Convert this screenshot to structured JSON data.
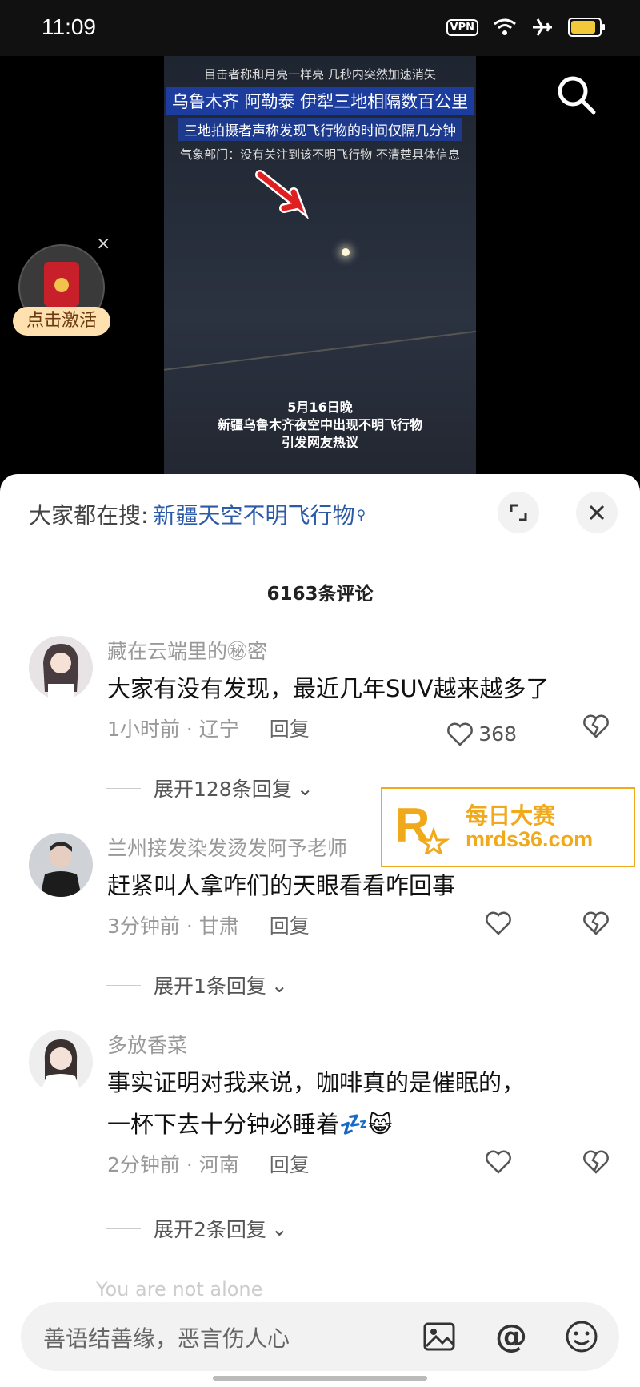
{
  "status_bar": {
    "time": "11:09",
    "vpn": "VPN",
    "battery_color": "#f0c83a",
    "battery_level": 0.9
  },
  "video": {
    "captions_top": [
      "目击者称和月亮一样亮 几秒内突然加速消失",
      "乌鲁木齐 阿勒泰 伊犁三地相隔数百公里",
      "三地拍摄者声称发现飞行物的时间仅隔几分钟",
      "气象部门：没有关注到该不明飞行物 不清楚具体信息"
    ],
    "captions_bottom": [
      "5月16日晚",
      "新疆乌鲁木齐夜空中出现不明飞行物",
      "引发网友热议"
    ],
    "red_packet_label": "点击激活",
    "close_glyph": "×"
  },
  "panel": {
    "search_prefix": "大家都在搜:",
    "search_term": "新疆天空不明飞行物",
    "comment_count": "6163条评论"
  },
  "comments": [
    {
      "user": "藏在云端里的㊙密",
      "text": [
        "大家有没有发现，最近几年SUV越来越多了"
      ],
      "time_loc": "1小时前 · 辽宁",
      "reply": "回复",
      "likes": "368",
      "expand": "展开128条回复"
    },
    {
      "user": "兰州接发染发烫发阿予老师",
      "text": [
        "赶紧叫人拿咋们的天眼看看咋回事"
      ],
      "time_loc": "3分钟前 · 甘肃",
      "reply": "回复",
      "likes": "",
      "expand": "展开1条回复"
    },
    {
      "user": "多放香菜",
      "text": [
        "事实证明对我来说，咖啡真的是催眠的，",
        "一杯下去十分钟必睡着💤😸"
      ],
      "time_loc": "2分钟前 · 河南",
      "reply": "回复",
      "likes": "",
      "expand": "展开2条回复"
    }
  ],
  "peek_user": "You are not alone",
  "watermark": {
    "line1": "每日大赛",
    "line2": "mrds36.com",
    "color": "#f0a91a"
  },
  "input": {
    "placeholder": "善语结善缘，恶言伤人心",
    "at": "@"
  }
}
